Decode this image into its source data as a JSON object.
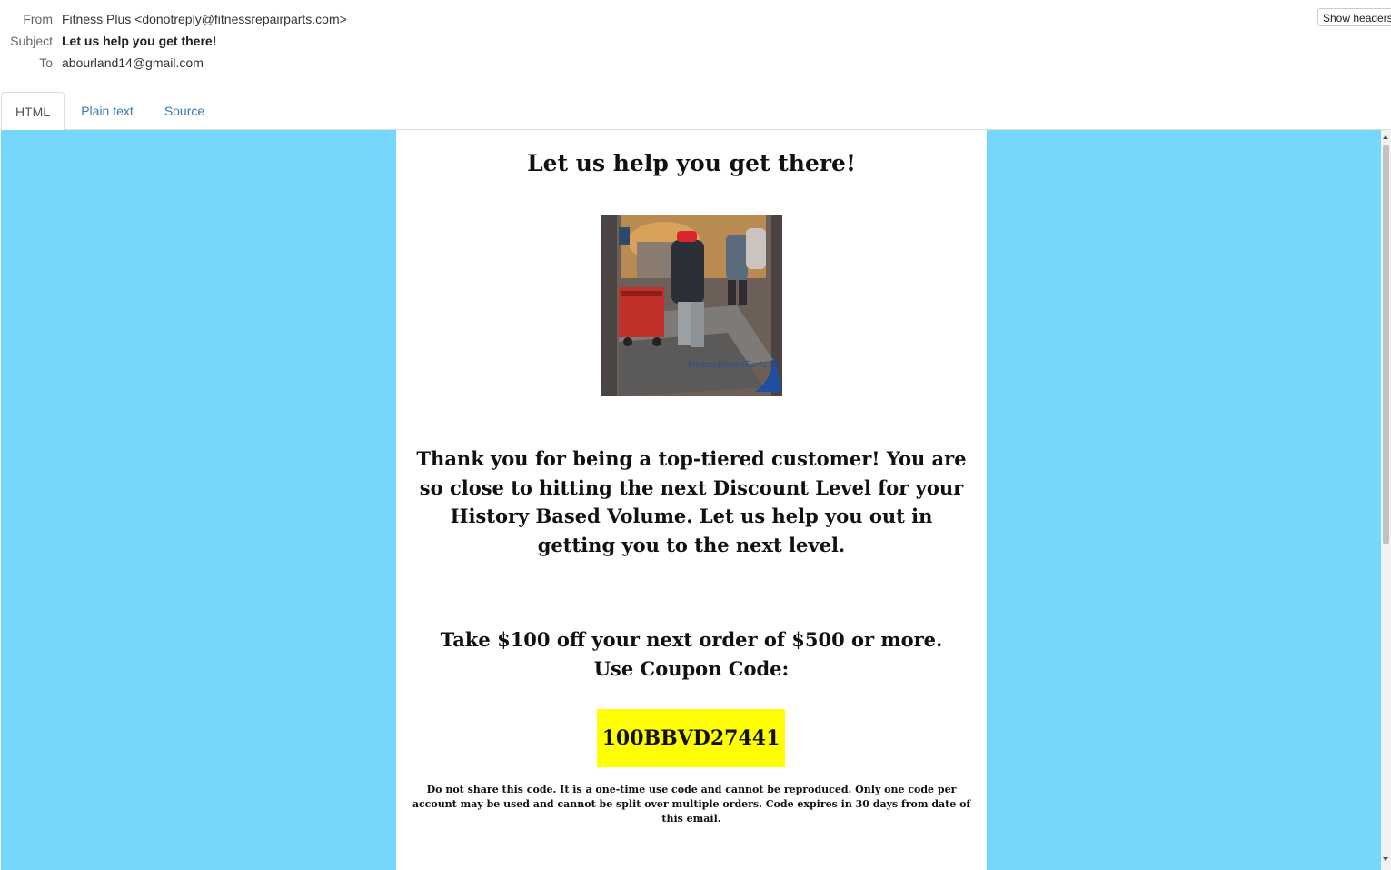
{
  "header": {
    "from_label": "From",
    "from_value": "Fitness Plus <donotreply@fitnessrepairparts.com>",
    "subject_label": "Subject",
    "subject_value": "Let us help you get there!",
    "to_label": "To",
    "to_value": "abourland14@gmail.com",
    "show_headers": "Show headers"
  },
  "tabs": [
    {
      "label": "HTML",
      "active": true
    },
    {
      "label": "Plain text",
      "active": false
    },
    {
      "label": "Source",
      "active": false
    }
  ],
  "email": {
    "title": "Let us help you get there!",
    "image_watermark": "FitnessRepairParts.com",
    "message": "Thank you for being a top-tiered customer! You are so close to hitting the next Discount Level for your History Based Volume. Let us help you out in getting you to the next level.",
    "offer": "Take $100 off your next order of $500 or more. Use Coupon Code:",
    "coupon_code": "100BBVD27441",
    "fine_print": "Do not share this code. It is a one-time use code and cannot be reproduced. Only one code per account may be used and cannot be split over multiple orders. Code expires in 30 days from date of this email."
  },
  "colors": {
    "background": "#76d7fc",
    "coupon_bg": "#ffff00",
    "link": "#337ab7"
  }
}
